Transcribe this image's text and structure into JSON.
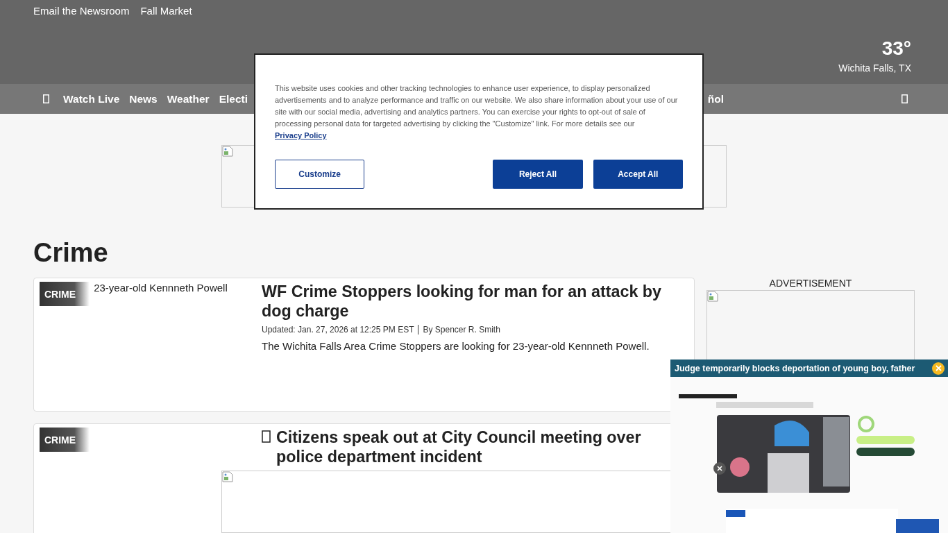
{
  "top_links": [
    "Email the Newsroom",
    "Fall Market"
  ],
  "weather": {
    "temperature": "33°",
    "location": "Wichita Falls, TX"
  },
  "nav": {
    "items": [
      "Watch Live",
      "News",
      "Weather",
      "Electi"
    ],
    "trailing_item": "ñol"
  },
  "section_title": "Crime",
  "articles": [
    {
      "category": "CRIME",
      "image_alt": "23-year-old Kennneth Powell",
      "headline_icon": false,
      "headline": "WF Crime Stoppers looking for man for an attack by dog charge",
      "updated": "Updated: Jan. 27, 2026 at 12:25 PM EST",
      "byline": "By Spencer R. Smith",
      "summary": "The Wichita Falls Area Crime Stoppers are looking for 23-year-old Kennneth Powell."
    },
    {
      "category": "CRIME",
      "headline_icon": true,
      "headline": "Citizens speak out at City Council meeting over police department incident"
    }
  ],
  "sidebar_ad": {
    "label": "ADVERTISEMENT"
  },
  "cookie_banner": {
    "text": "This website uses cookies and other tracking technologies to enhance user experience, to display personalized advertisements and to analyze performance and traffic on our website. We also share information about your use of our site with our social media, advertising and analytics partners. You can exercise your rights to opt-out of sale of processing personal data for targeted advertising by clicking the \"Customize\" link. For more details see our",
    "link": "Privacy Policy",
    "buttons": [
      {
        "label": "Customize",
        "kind": "outline"
      },
      {
        "label": "Reject All",
        "kind": "solid"
      },
      {
        "label": "Accept All",
        "kind": "solid"
      }
    ]
  },
  "video_player": {
    "title": "Judge temporarily blocks deportation of young boy, father"
  }
}
